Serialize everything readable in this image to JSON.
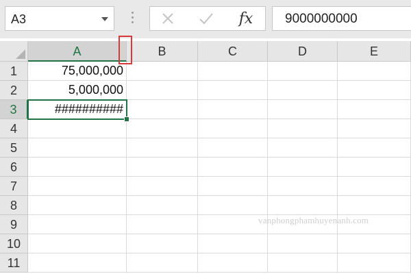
{
  "formula_bar": {
    "name_box": "A3",
    "cancel_icon": "close-icon",
    "enter_icon": "check-icon",
    "insert_function_label": "fx",
    "formula_value": "9000000000"
  },
  "grid": {
    "columns": [
      "A",
      "B",
      "C",
      "D",
      "E"
    ],
    "rows": [
      "1",
      "2",
      "3",
      "4",
      "5",
      "6",
      "7",
      "8",
      "9",
      "10",
      "11"
    ],
    "selected_column": "A",
    "selected_row": "3",
    "cells": {
      "A1": "75,000,000",
      "A2": "5,000,000",
      "A3": "##########"
    }
  },
  "watermark": "vanphongphamhuyenanh.com",
  "colors": {
    "accent_green": "#217346",
    "highlight_red": "#d63a3a"
  }
}
